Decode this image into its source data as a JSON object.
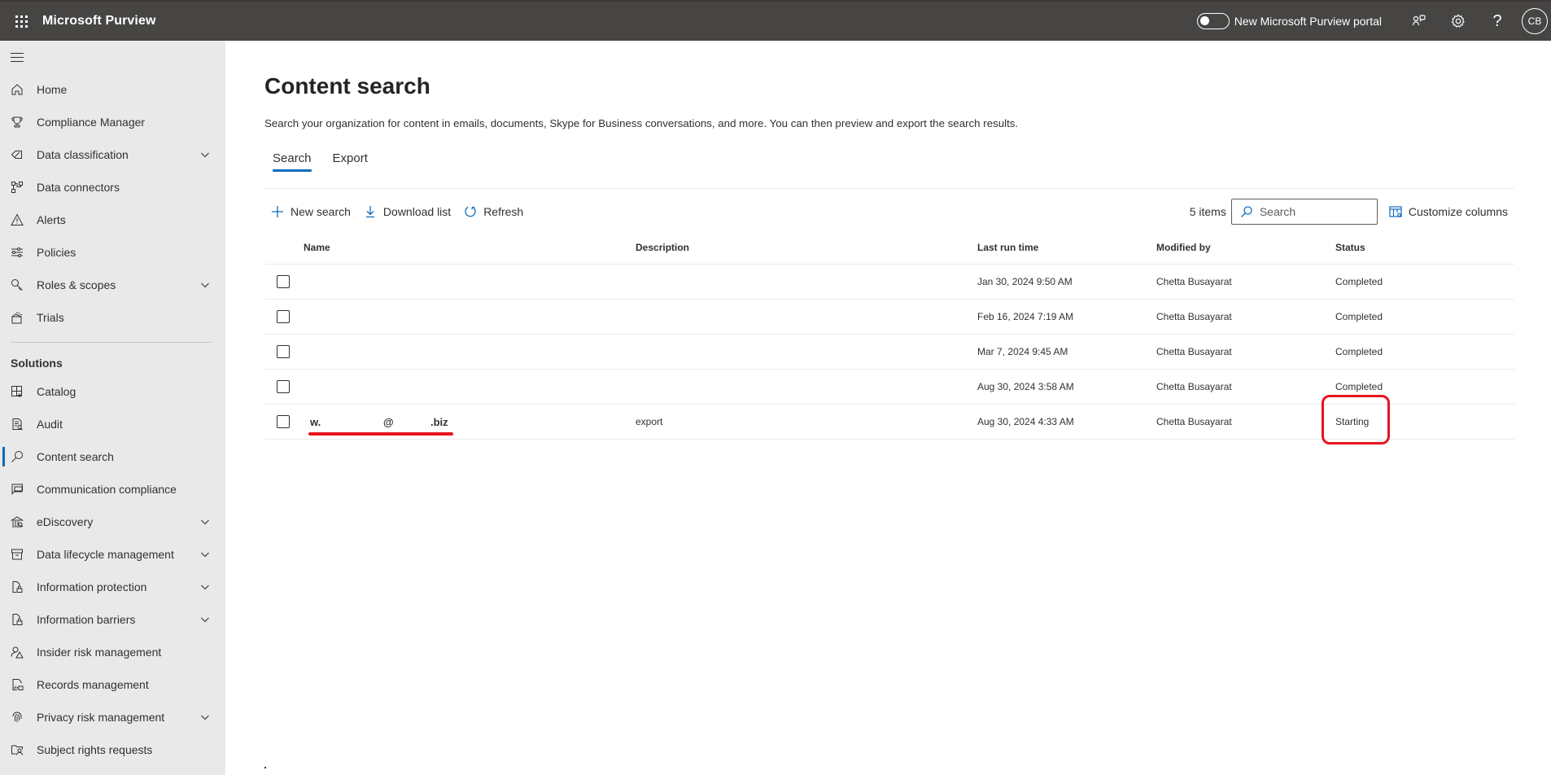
{
  "topbar": {
    "app_title": "Microsoft Purview",
    "toggle_label": "New Microsoft Purview portal",
    "toggle_on": false,
    "icons": [
      "community-icon",
      "settings-icon",
      "help-icon"
    ],
    "help_glyph": "?",
    "avatar_initials": "CB"
  },
  "sidebar": {
    "items": [
      {
        "label": "Home",
        "icon": "home-icon",
        "expandable": false
      },
      {
        "label": "Compliance Manager",
        "icon": "trophy-icon",
        "expandable": false
      },
      {
        "label": "Data classification",
        "icon": "tag-icon",
        "expandable": true
      },
      {
        "label": "Data connectors",
        "icon": "connector-icon",
        "expandable": false
      },
      {
        "label": "Alerts",
        "icon": "warning-icon",
        "expandable": false
      },
      {
        "label": "Policies",
        "icon": "sliders-icon",
        "expandable": false
      },
      {
        "label": "Roles & scopes",
        "icon": "key-icon",
        "expandable": true
      },
      {
        "label": "Trials",
        "icon": "gift-icon",
        "expandable": false
      }
    ],
    "section_title": "Solutions",
    "solutions": [
      {
        "label": "Catalog",
        "icon": "catalog-icon",
        "expandable": false
      },
      {
        "label": "Audit",
        "icon": "audit-icon",
        "expandable": false
      },
      {
        "label": "Content search",
        "icon": "search-icon",
        "expandable": false,
        "active": true
      },
      {
        "label": "Communication compliance",
        "icon": "chat-icon",
        "expandable": false
      },
      {
        "label": "eDiscovery",
        "icon": "ediscovery-icon",
        "expandable": true
      },
      {
        "label": "Data lifecycle management",
        "icon": "archive-icon",
        "expandable": true
      },
      {
        "label": "Information protection",
        "icon": "doc-lock-icon",
        "expandable": true
      },
      {
        "label": "Information barriers",
        "icon": "doc-lock-icon",
        "expandable": true
      },
      {
        "label": "Insider risk management",
        "icon": "person-warning-icon",
        "expandable": false
      },
      {
        "label": "Records management",
        "icon": "records-icon",
        "expandable": false
      },
      {
        "label": "Privacy risk management",
        "icon": "fingerprint-icon",
        "expandable": true
      },
      {
        "label": "Subject rights requests",
        "icon": "folder-person-icon",
        "expandable": false
      }
    ]
  },
  "main": {
    "title": "Content search",
    "description": "Search your organization for content in emails, documents, Skype for Business conversations, and more. You can then preview and export the search results.",
    "tabs": [
      {
        "label": "Search",
        "active": true
      },
      {
        "label": "Export",
        "active": false
      }
    ],
    "toolbar": {
      "new_search": "New search",
      "download_list": "Download list",
      "refresh": "Refresh",
      "item_count": "5 items",
      "search_placeholder": "Search",
      "customize_columns": "Customize columns"
    },
    "table": {
      "columns": [
        "Name",
        "Description",
        "Last run time",
        "Modified by",
        "Status"
      ],
      "rows": [
        {
          "name": "",
          "description": "",
          "last_run": "Jan 30, 2024 9:50 AM",
          "modified_by": "Chetta Busayarat",
          "status": "Completed"
        },
        {
          "name": "",
          "description": "",
          "last_run": "Feb 16, 2024 7:19 AM",
          "modified_by": "Chetta Busayarat",
          "status": "Completed"
        },
        {
          "name": "",
          "description": "",
          "last_run": "Mar 7, 2024 9:45 AM",
          "modified_by": "Chetta Busayarat",
          "status": "Completed"
        },
        {
          "name": "",
          "description": "",
          "last_run": "Aug 30, 2024 3:58 AM",
          "modified_by": "Chetta Busayarat",
          "status": "Completed"
        },
        {
          "name_parts": [
            "w.",
            "@",
            ".biz"
          ],
          "description": "export",
          "last_run": "Aug 30, 2024 4:33 AM",
          "modified_by": "Chetta Busayarat",
          "status": "Starting",
          "highlighted": true
        }
      ]
    }
  },
  "colors": {
    "topbar_bg": "#464543",
    "sidebar_bg": "#e9e9e9",
    "accent": "#0f6cbd",
    "annotation_red": "#e8141f"
  }
}
